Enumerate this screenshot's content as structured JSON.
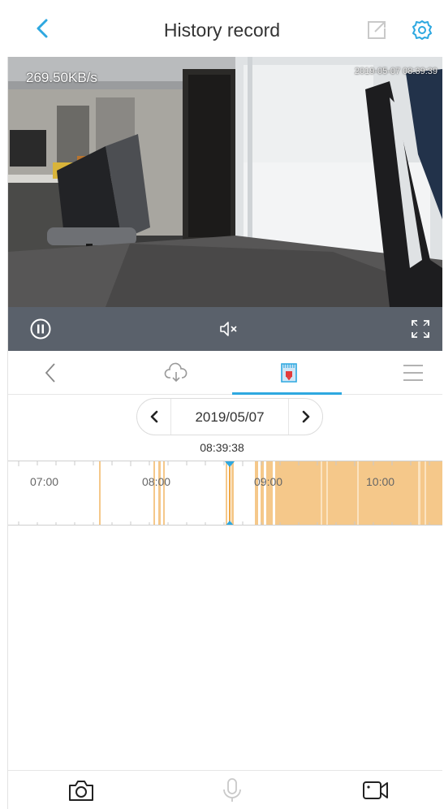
{
  "header": {
    "title": "History record",
    "back_icon": "chevron-left-icon",
    "share_icon": "share-icon",
    "settings_icon": "gear-icon",
    "accent_color": "#2ea8e0"
  },
  "video": {
    "bitrate": "269.50KB/s",
    "timestamp": "2019-05-07 08:39:39"
  },
  "player_controls": {
    "pause_icon": "pause-icon",
    "mute_icon": "speaker-muted-icon",
    "fullscreen_icon": "fullscreen-icon"
  },
  "tabs": [
    {
      "icon": "chevron-left-icon",
      "active": false
    },
    {
      "icon": "cloud-download-icon",
      "active": false
    },
    {
      "icon": "sd-card-icon",
      "active": true
    },
    {
      "icon": "menu-icon",
      "active": false
    }
  ],
  "date_selector": {
    "date": "2019/05/07"
  },
  "current_time": "08:39:38",
  "timeline": {
    "tick_labels": [
      "07:00",
      "08:00",
      "09:00",
      "10:00"
    ],
    "record_color": "#f5c88a"
  },
  "bottom_bar": {
    "snapshot_icon": "camera-icon",
    "talk_icon": "microphone-icon",
    "record_icon": "video-record-icon"
  }
}
